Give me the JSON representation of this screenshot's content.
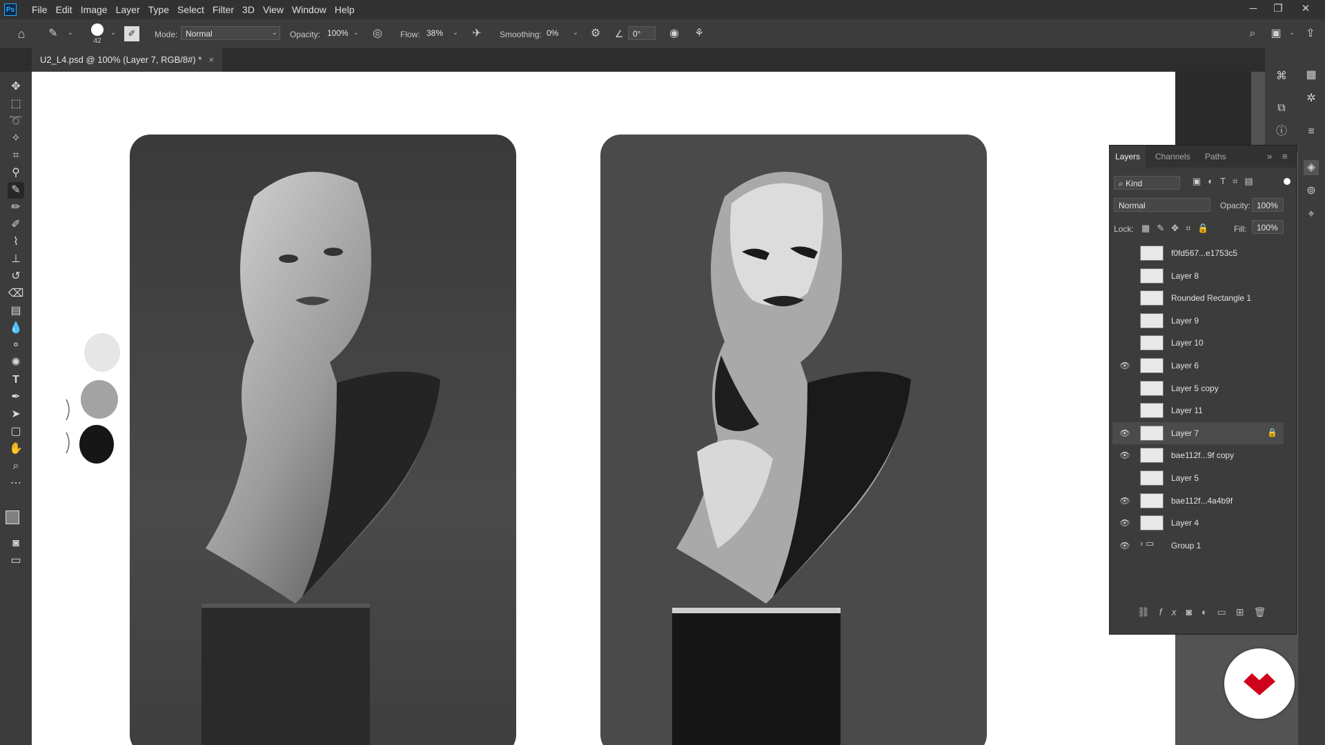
{
  "app": {
    "logo": "Ps"
  },
  "menu": [
    "File",
    "Edit",
    "Image",
    "Layer",
    "Type",
    "Select",
    "Filter",
    "3D",
    "View",
    "Window",
    "Help"
  ],
  "window_controls": {
    "minimize": "─",
    "restore": "❐",
    "close": "✕"
  },
  "options": {
    "brush_size": "42",
    "mode_label": "Mode:",
    "mode_value": "Normal",
    "opacity_label": "Opacity:",
    "opacity_value": "100%",
    "flow_label": "Flow:",
    "flow_value": "38%",
    "smoothing_label": "Smoothing:",
    "smoothing_value": "0%",
    "angle_value": "0°"
  },
  "document_tab": {
    "title": "U2_L4.psd @ 100% (Layer 7, RGB/8#) *",
    "close": "×"
  },
  "layers_panel": {
    "tabs": [
      "Layers",
      "Channels",
      "Paths"
    ],
    "filter_kind": "Kind",
    "blend_mode": "Normal",
    "opacity_label": "Opacity:",
    "opacity_value": "100%",
    "lock_label": "Lock:",
    "fill_label": "Fill:",
    "fill_value": "100%",
    "layers": [
      {
        "name": "f0fd567...e1753c5",
        "visible": false
      },
      {
        "name": "Layer 8",
        "visible": false
      },
      {
        "name": "Rounded Rectangle 1",
        "visible": false
      },
      {
        "name": "Layer 9",
        "visible": false
      },
      {
        "name": "Layer 10",
        "visible": false
      },
      {
        "name": "Layer 6",
        "visible": true
      },
      {
        "name": "Layer 5 copy",
        "visible": false
      },
      {
        "name": "Layer 11",
        "visible": false
      },
      {
        "name": "Layer 7",
        "visible": true,
        "selected": true,
        "locked": true
      },
      {
        "name": "bae112f...9f copy",
        "visible": true
      },
      {
        "name": "Layer 5",
        "visible": false
      },
      {
        "name": "bae112f...4a4b9f",
        "visible": true
      },
      {
        "name": "Layer 4",
        "visible": true
      },
      {
        "name": "Group 1",
        "visible": true,
        "group": true
      }
    ],
    "footer_icons": [
      "link-icon",
      "fx-icon",
      "mask-icon",
      "adjustment-icon",
      "folder-icon",
      "new-layer-icon",
      "trash-icon"
    ]
  },
  "colors": {
    "accent": "#31a8ff",
    "badge_red": "#d0021b",
    "panel": "#323232",
    "canvas": "#ffffff"
  }
}
